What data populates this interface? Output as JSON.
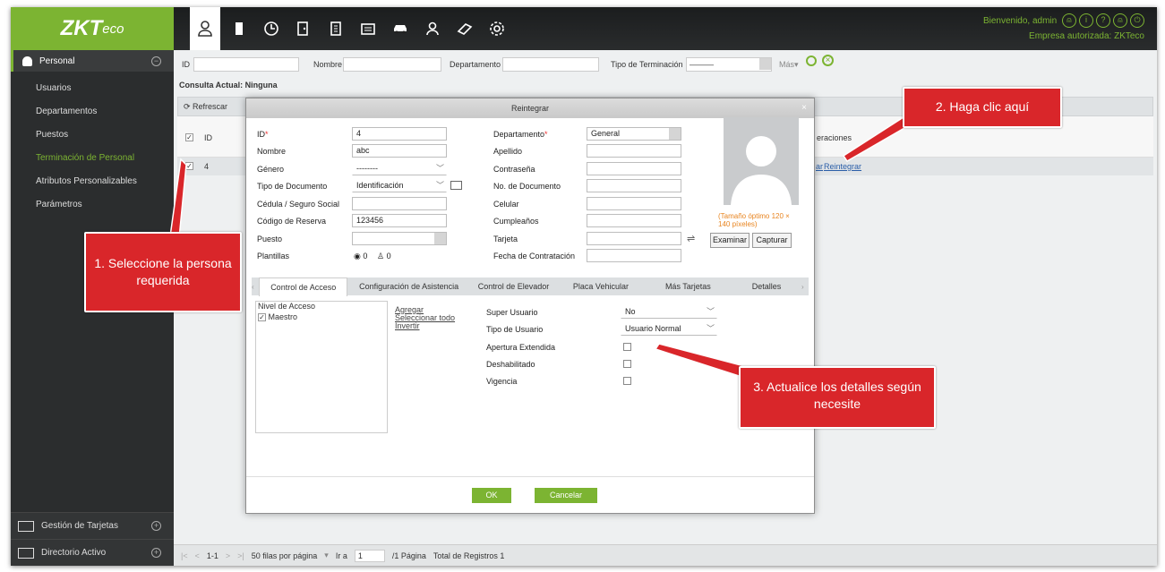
{
  "brand": {
    "logo": "ZKT",
    "logo_suffix": "eco"
  },
  "header": {
    "welcome": "Bienvenido, admin",
    "company": "Empresa autorizada: ZKTeco",
    "modules": [
      "personnel-icon",
      "card-door-icon",
      "clock-icon",
      "access-icon",
      "building-icon",
      "folder-icon",
      "car-icon",
      "visitor-icon",
      "patrol-icon",
      "settings-icon"
    ]
  },
  "sidebar": {
    "module_title": "Personal",
    "items": [
      "Usuarios",
      "Departamentos",
      "Puestos",
      "Terminación de Personal",
      "Atributos Personalizables",
      "Parámetros"
    ],
    "bottom": [
      "Gestión de Tarjetas",
      "Directorio Activo"
    ]
  },
  "filter": {
    "id_label": "ID",
    "name_label": "Nombre",
    "dept_label": "Departamento",
    "term_label": "Tipo de Terminación",
    "term_value": "———",
    "more": "Más▾",
    "query": "Consulta Actual: Ninguna"
  },
  "toolbar": {
    "refresh": "Refrescar"
  },
  "table": {
    "col_id": "ID",
    "col_ops": "eraciones",
    "row_id": "4",
    "row_ops_prefix": "ar",
    "row_ops_link": "Reintegrar"
  },
  "pager": {
    "range": "1-1",
    "per_page": "50 filas por página",
    "goto": "Ir a",
    "page_value": "1",
    "page_total": "/1 Página",
    "total": "Total de Registros 1"
  },
  "dialog": {
    "title": "Reintegrar",
    "left_fields": {
      "id_label": "ID",
      "id_value": "4",
      "nombre_label": "Nombre",
      "nombre_value": "abc",
      "genero_label": "Género",
      "genero_value": "--------",
      "tipodoc_label": "Tipo de Documento",
      "tipodoc_value": "Identificación",
      "cedula_label": "Cédula / Seguro Social",
      "reserva_label": "Código de Reserva",
      "reserva_value": "123456",
      "puesto_label": "Puesto",
      "plantillas_label": "Plantillas",
      "fp_count": "0",
      "face_count": "0"
    },
    "right_fields": {
      "depto_label": "Departamento",
      "depto_value": "General",
      "apellido_label": "Apellido",
      "contrasena_label": "Contraseña",
      "nodoc_label": "No. de Documento",
      "celular_label": "Celular",
      "cumple_label": "Cumpleaños",
      "tarjeta_label": "Tarjeta",
      "contratacion_label": "Fecha de Contratación"
    },
    "photo_hint": "(Tamaño óptimo 120 × 140 píxeles)",
    "examinar": "Examinar",
    "capturar": "Capturar",
    "tabs": [
      "Control de Acceso",
      "Configuración de Asistencia",
      "Control de Elevador",
      "Placa Vehicular",
      "Más Tarjetas",
      "Detalles"
    ],
    "access": {
      "level_title": "Nivel de Acceso",
      "level_item": "Maestro",
      "agregar": "Agregar",
      "seleccionar": "Seleccionar todo",
      "invertir": "Invertir",
      "super_label": "Super Usuario",
      "super_value": "No",
      "tipo_label": "Tipo de Usuario",
      "tipo_value": "Usuario Normal",
      "apertura_label": "Apertura Extendida",
      "deshab_label": "Deshabilitado",
      "vigencia_label": "Vigencia"
    },
    "ok": "OK",
    "cancel": "Cancelar"
  },
  "callouts": {
    "step1": "1. Seleccione la persona requerida",
    "step2": "2. Haga clic aquí",
    "step3": "3. Actualice los detalles según necesite"
  },
  "colors": {
    "accent": "#7cb432",
    "callout": "#d9262a",
    "hint": "#e8841f"
  }
}
